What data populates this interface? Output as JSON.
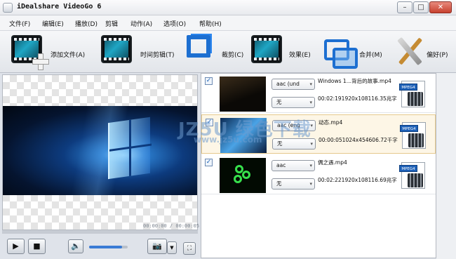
{
  "app": {
    "title": "iDealshare VideoGo 6"
  },
  "menu": [
    "文件(F)",
    "编辑(E)",
    "播放(D)",
    "剪辑",
    "动作(A)",
    "选项(O)",
    "帮助(H)"
  ],
  "toolbar": {
    "add_file": "添加文件(A)",
    "trim": "时间剪辑(T)",
    "crop": "裁剪(C)",
    "effect": "效果(E)",
    "merge": "合并(M)",
    "prefs": "偏好(P)"
  },
  "player": {
    "timecode": "00:00:00 / 00:00:05",
    "progress": 0.0,
    "volume": 0.85
  },
  "files": [
    {
      "checked": true,
      "audio": "aac (und",
      "subtitle": "无",
      "name": "Windows 1…背后的故事.mp4",
      "info": "00:02:191920x108116.35兆字",
      "format": "MPEG4"
    },
    {
      "checked": true,
      "audio": "aac (eng",
      "subtitle": "无",
      "name": "动态.mp4",
      "info": "00:00:051024x454606.72千字",
      "format": "MPEG4"
    },
    {
      "checked": true,
      "audio": "aac",
      "subtitle": "无",
      "name": "偶之遇.mp4",
      "info": "00:02:221920x108116.69兆字",
      "format": "MPEG4"
    }
  ],
  "watermark": {
    "line1": "JZ5U 绿色下载",
    "line2": "www.jz5u.com"
  }
}
